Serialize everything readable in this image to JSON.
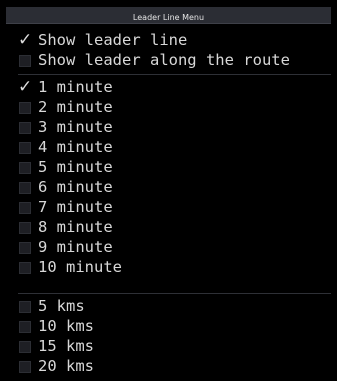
{
  "title": "Leader Line Menu",
  "sections": [
    {
      "items": [
        {
          "label": "Show leader line",
          "checked": true
        },
        {
          "label": "Show leader along the route",
          "checked": false
        }
      ]
    },
    {
      "items": [
        {
          "label": "1 minute",
          "checked": true
        },
        {
          "label": "2 minute",
          "checked": false
        },
        {
          "label": "3 minute",
          "checked": false
        },
        {
          "label": "4 minute",
          "checked": false
        },
        {
          "label": "5 minute",
          "checked": false
        },
        {
          "label": "6 minute",
          "checked": false
        },
        {
          "label": "7 minute",
          "checked": false
        },
        {
          "label": "8 minute",
          "checked": false
        },
        {
          "label": "9 minute",
          "checked": false
        },
        {
          "label": "10 minute",
          "checked": false
        }
      ]
    },
    {
      "items": [
        {
          "label": "5 kms",
          "checked": false
        },
        {
          "label": "10 kms",
          "checked": false
        },
        {
          "label": "15 kms",
          "checked": false
        },
        {
          "label": "20 kms",
          "checked": false
        }
      ]
    }
  ]
}
